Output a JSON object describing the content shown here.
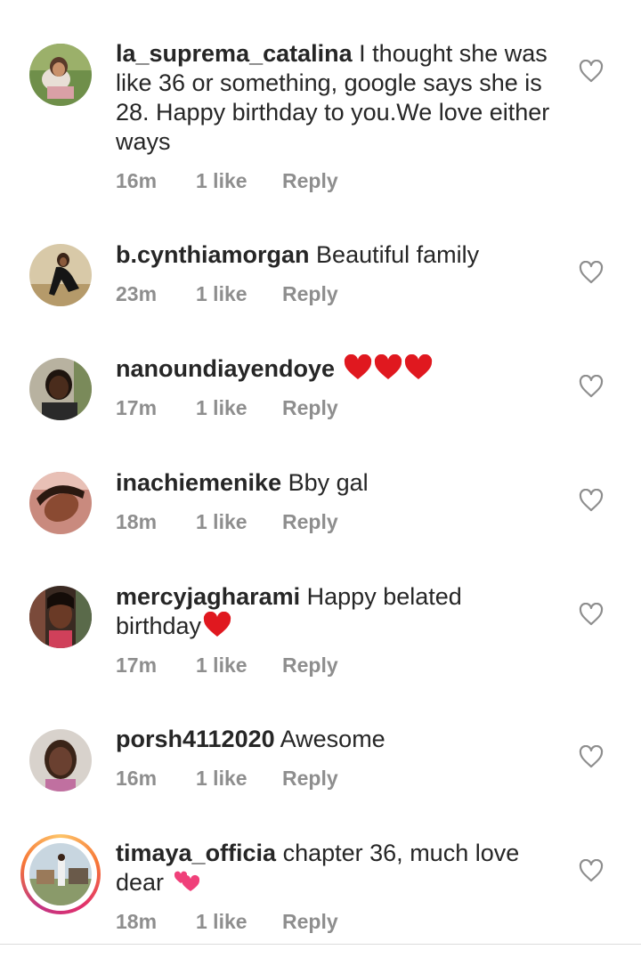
{
  "comments": [
    {
      "username": "la_suprema_catalina",
      "text": "I thought she was like 36 or something, google says she is 28. Happy birthday to you.We love either ways",
      "time": "16m",
      "likes": "1 like",
      "reply": "Reply",
      "avatar_icon": "profile-photo"
    },
    {
      "username": "b.cynthiamorgan",
      "text": "Beautiful family",
      "time": "23m",
      "likes": "1 like",
      "reply": "Reply",
      "avatar_icon": "profile-photo"
    },
    {
      "username": "nanoundiayendoye",
      "text": "",
      "emoji": "❤️❤️❤️",
      "time": "17m",
      "likes": "1 like",
      "reply": "Reply",
      "avatar_icon": "profile-photo"
    },
    {
      "username": "inachiemenike",
      "text": "Bby gal",
      "time": "18m",
      "likes": "1 like",
      "reply": "Reply",
      "avatar_icon": "profile-photo"
    },
    {
      "username": "mercyjagharami",
      "text": "Happy belated birthday",
      "emoji": "❤️",
      "time": "17m",
      "likes": "1 like",
      "reply": "Reply",
      "avatar_icon": "profile-photo"
    },
    {
      "username": "porsh4112020",
      "text": "Awesome",
      "time": "16m",
      "likes": "1 like",
      "reply": "Reply",
      "avatar_icon": "profile-photo"
    },
    {
      "username": "timaya_officia",
      "text": "chapter 36, much love dear",
      "emoji": "💕",
      "time": "18m",
      "likes": "1 like",
      "reply": "Reply",
      "avatar_icon": "profile-photo-with-story-ring"
    }
  ],
  "icons": {
    "like": "heart-outline-icon",
    "emoji_heart": "red-heart-emoji"
  },
  "colors": {
    "text": "#262626",
    "meta": "#8e8e8e",
    "heart_emoji": "#e0181f",
    "story_ring": "#f77737"
  }
}
